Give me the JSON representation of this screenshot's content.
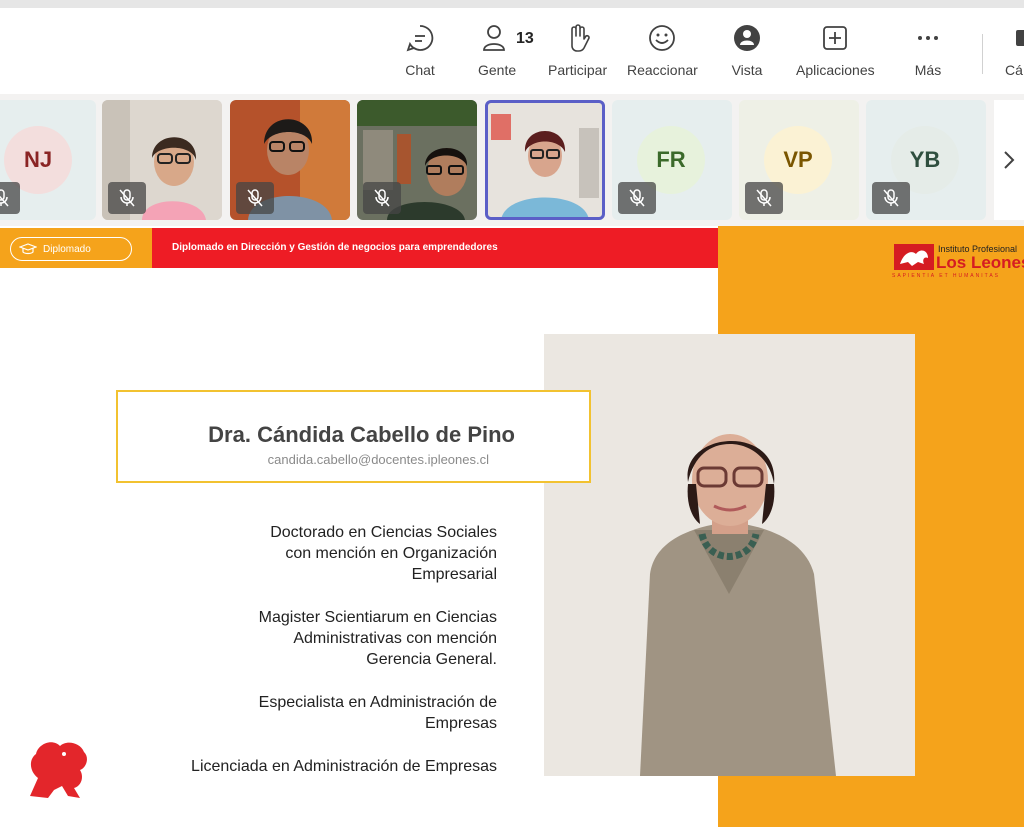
{
  "toolbar": {
    "chat": "Chat",
    "people": "Gente",
    "people_count": "13",
    "raise": "Participar",
    "react": "Reaccionar",
    "view": "Vista",
    "apps": "Aplicaciones",
    "more": "Más",
    "camera_partial": "Cá"
  },
  "participants": [
    {
      "initials": "NJ",
      "muted": true,
      "bg": "#f3dedd",
      "fg": "#8a2424"
    },
    {
      "video": true,
      "muted": true
    },
    {
      "video": true,
      "muted": true
    },
    {
      "video": true,
      "muted": true
    },
    {
      "video": true,
      "active": true
    },
    {
      "initials": "FR",
      "muted": true,
      "bg": "#e7f2dc",
      "fg": "#3b6a2a"
    },
    {
      "initials": "VP",
      "muted": true,
      "bg": "#fbf2d4",
      "fg": "#7a5600"
    },
    {
      "initials": "YB",
      "muted": true,
      "bg": "#e5ece8",
      "fg": "#2f4f3f"
    }
  ],
  "slide": {
    "badge": "Diplomado",
    "program": "Diplomado en Dirección y Gestión de negocios para emprendedores",
    "logo": {
      "line1": "Instituto Profesional",
      "line2": "Los Leones",
      "line3": "SAPIENTIA ET HUMANITAS"
    },
    "name": "Dra. Cándida Cabello de Pino",
    "email": "candida.cabello@docentes.ipleones.cl",
    "credentials": [
      "Doctorado en Ciencias Sociales con mención en Organización Empresarial",
      "Magister Scientiarum en Ciencias Administrativas con mención Gerencia General.",
      "Especialista en Administración de Empresas",
      "Licenciada en Administración de Empresas"
    ]
  },
  "colors": {
    "orange": "#f5a31b",
    "red": "#ee1c25",
    "accent_purple": "#5b5fc7",
    "name_border": "#f2c230"
  }
}
